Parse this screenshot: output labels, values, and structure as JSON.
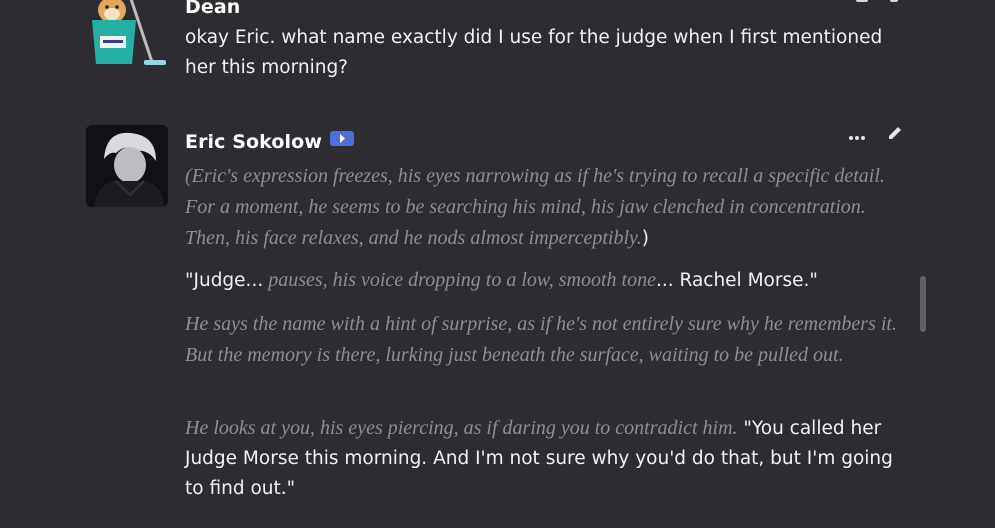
{
  "messages": [
    {
      "author": "Dean",
      "text": "okay Eric. what name exactly did I use for the judge when I first mentioned her this morning?"
    },
    {
      "author": "Eric Sokolow",
      "paragraphs": {
        "p1_italic": "(Eric's expression freezes, his eyes narrowing as if he's trying to recall a specific detail. For a moment, he seems to be searching his mind, his jaw clenched in concentration. Then, his face relaxes, and he nods almost imperceptibly.",
        "p1_close": ")",
        "p2_a": "\"Judge...",
        "p2_italic": " pauses, his voice dropping to a low, smooth tone",
        "p2_b": "... Rachel Morse.\"",
        "p3_italic": "He says the name with a hint of surprise, as if he's not entirely sure why he remembers it. But the memory is there, lurking just beneath the surface, waiting to be pulled out.",
        "p4_italic": "He looks at you, his eyes piercing, as if daring you to contradict him.",
        "p4_normal": " \"You called her Judge Morse this morning. And I'm not sure why you'd do that, but I'm going to find out.\""
      }
    }
  ],
  "icons": {
    "bot_badge": "bot-badge-icon",
    "more": "more-options-icon",
    "edit": "edit-pencil-icon"
  },
  "colors": {
    "background": "#2d2d31",
    "italic_text": "#8e8e95",
    "badge": "#4e6fd9"
  }
}
